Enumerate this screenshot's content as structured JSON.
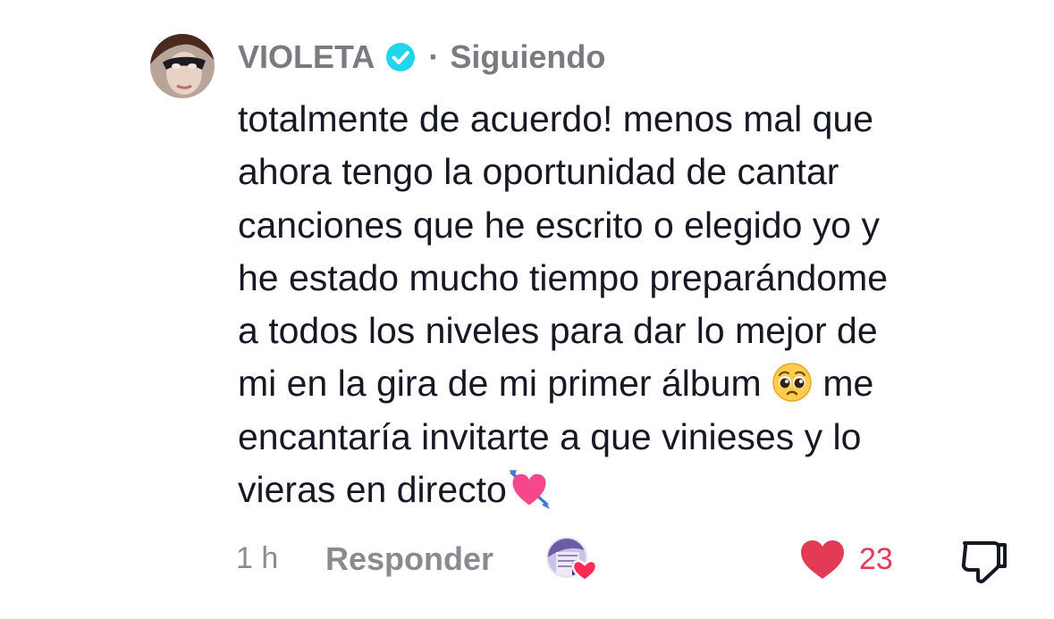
{
  "comment": {
    "author": {
      "name": "VIOLETA",
      "verified_icon": "verified-badge-icon",
      "separator": "·",
      "follow_status": "Siguiendo"
    },
    "text_lines": [
      "totalmente de acuerdo! menos mal que",
      "ahora tengo la oportunidad de cantar",
      "canciones que he escrito o elegido yo y",
      "he estado mucho tiempo preparándome",
      "a todos los niveles para dar lo mejor de",
      "mi en la gira de mi primer álbum",
      "me",
      "encantaría invitarte a que vinieses y lo",
      "vieras en directo"
    ],
    "emojis": [
      "pleading-face-emoji",
      "heart-with-arrow-emoji"
    ],
    "time": "1 h",
    "reply_label": "Responder",
    "likes": "23",
    "colors": {
      "like_red": "#e33b56",
      "verified_blue": "#20d5ec",
      "muted_text": "#8a8b91"
    }
  }
}
